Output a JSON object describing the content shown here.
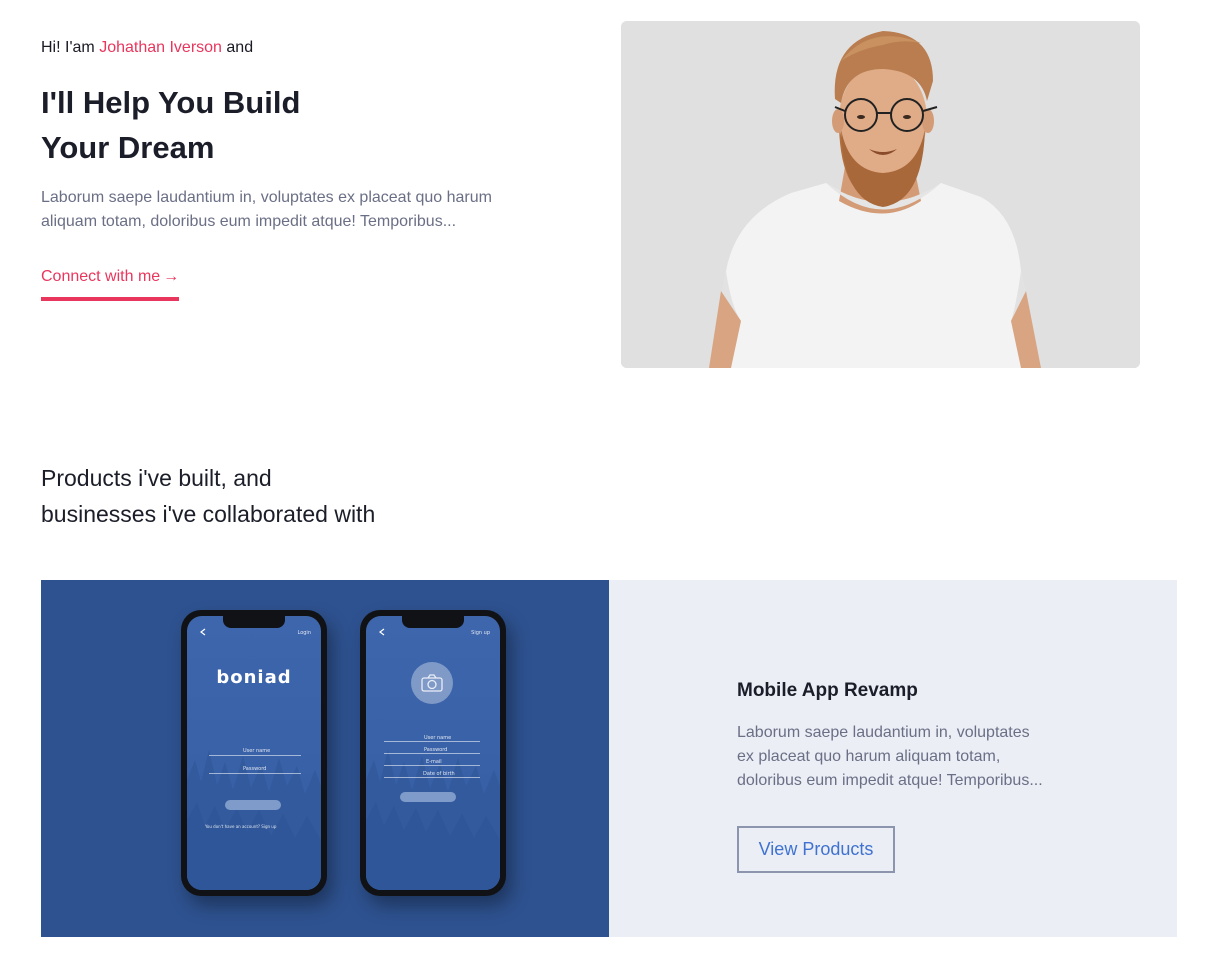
{
  "hero": {
    "greeting_prefix": "Hi! I'am",
    "name": "Johathan Iverson",
    "greeting_suffix": "and",
    "headline_line1": "I'll Help You Build",
    "headline_line2": "Your Dream",
    "description_line1": "Laborum saepe laudantium in, voluptates ex placeat quo harum",
    "description_line2": "aliquam totam, doloribus eum impedit atque! Temporibus...",
    "cta_label": "Connect with me",
    "cta_arrow": "→"
  },
  "products": {
    "heading_line1": "Products i've built, and",
    "heading_line2": "businesses i've collaborated with",
    "card": {
      "title": "Mobile App Revamp",
      "description_line1": "Laborum saepe laudantium in, voluptates",
      "description_line2": "ex placeat quo harum aliquam totam,",
      "description_line3": "doloribus eum impedit atque! Temporibus...",
      "button_label": "View Products",
      "mockup": {
        "brand": "boniad",
        "left_top_right": "Login",
        "left_field1": "User name",
        "left_field2": "Password",
        "left_footer": "You don't have an account? Sign up",
        "right_top_right": "Sign up",
        "right_field1": "User name",
        "right_field2": "Password",
        "right_field3": "E-mail",
        "right_field4": "Date of birth"
      }
    }
  },
  "colors": {
    "accent": "#e8365d",
    "product_media_bg": "#2e5290",
    "product_info_bg": "#ebeef5",
    "button_text": "#3f72d1"
  },
  "icons": {
    "cta_arrow": "arrow-right-icon",
    "camera": "camera-icon",
    "back": "chevron-left-icon"
  }
}
